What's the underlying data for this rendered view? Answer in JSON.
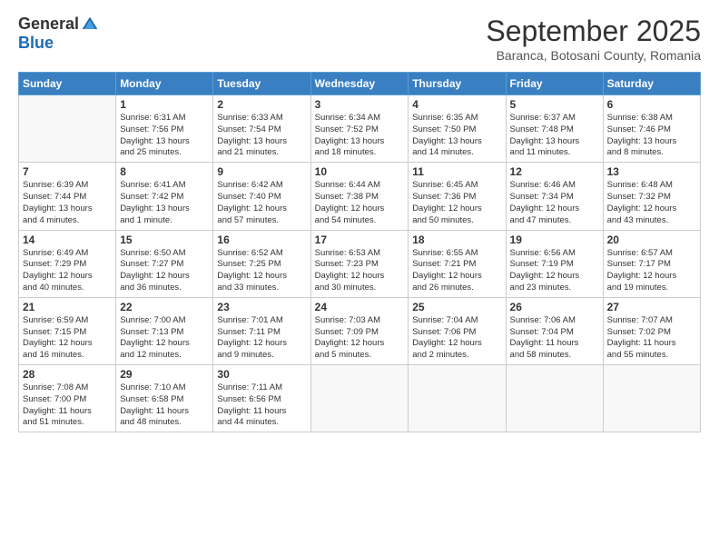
{
  "logo": {
    "general": "General",
    "blue": "Blue"
  },
  "title": "September 2025",
  "location": "Baranca, Botosani County, Romania",
  "days_of_week": [
    "Sunday",
    "Monday",
    "Tuesday",
    "Wednesday",
    "Thursday",
    "Friday",
    "Saturday"
  ],
  "weeks": [
    [
      {
        "day": "",
        "info": ""
      },
      {
        "day": "1",
        "info": "Sunrise: 6:31 AM\nSunset: 7:56 PM\nDaylight: 13 hours\nand 25 minutes."
      },
      {
        "day": "2",
        "info": "Sunrise: 6:33 AM\nSunset: 7:54 PM\nDaylight: 13 hours\nand 21 minutes."
      },
      {
        "day": "3",
        "info": "Sunrise: 6:34 AM\nSunset: 7:52 PM\nDaylight: 13 hours\nand 18 minutes."
      },
      {
        "day": "4",
        "info": "Sunrise: 6:35 AM\nSunset: 7:50 PM\nDaylight: 13 hours\nand 14 minutes."
      },
      {
        "day": "5",
        "info": "Sunrise: 6:37 AM\nSunset: 7:48 PM\nDaylight: 13 hours\nand 11 minutes."
      },
      {
        "day": "6",
        "info": "Sunrise: 6:38 AM\nSunset: 7:46 PM\nDaylight: 13 hours\nand 8 minutes."
      }
    ],
    [
      {
        "day": "7",
        "info": "Sunrise: 6:39 AM\nSunset: 7:44 PM\nDaylight: 13 hours\nand 4 minutes."
      },
      {
        "day": "8",
        "info": "Sunrise: 6:41 AM\nSunset: 7:42 PM\nDaylight: 13 hours\nand 1 minute."
      },
      {
        "day": "9",
        "info": "Sunrise: 6:42 AM\nSunset: 7:40 PM\nDaylight: 12 hours\nand 57 minutes."
      },
      {
        "day": "10",
        "info": "Sunrise: 6:44 AM\nSunset: 7:38 PM\nDaylight: 12 hours\nand 54 minutes."
      },
      {
        "day": "11",
        "info": "Sunrise: 6:45 AM\nSunset: 7:36 PM\nDaylight: 12 hours\nand 50 minutes."
      },
      {
        "day": "12",
        "info": "Sunrise: 6:46 AM\nSunset: 7:34 PM\nDaylight: 12 hours\nand 47 minutes."
      },
      {
        "day": "13",
        "info": "Sunrise: 6:48 AM\nSunset: 7:32 PM\nDaylight: 12 hours\nand 43 minutes."
      }
    ],
    [
      {
        "day": "14",
        "info": "Sunrise: 6:49 AM\nSunset: 7:29 PM\nDaylight: 12 hours\nand 40 minutes."
      },
      {
        "day": "15",
        "info": "Sunrise: 6:50 AM\nSunset: 7:27 PM\nDaylight: 12 hours\nand 36 minutes."
      },
      {
        "day": "16",
        "info": "Sunrise: 6:52 AM\nSunset: 7:25 PM\nDaylight: 12 hours\nand 33 minutes."
      },
      {
        "day": "17",
        "info": "Sunrise: 6:53 AM\nSunset: 7:23 PM\nDaylight: 12 hours\nand 30 minutes."
      },
      {
        "day": "18",
        "info": "Sunrise: 6:55 AM\nSunset: 7:21 PM\nDaylight: 12 hours\nand 26 minutes."
      },
      {
        "day": "19",
        "info": "Sunrise: 6:56 AM\nSunset: 7:19 PM\nDaylight: 12 hours\nand 23 minutes."
      },
      {
        "day": "20",
        "info": "Sunrise: 6:57 AM\nSunset: 7:17 PM\nDaylight: 12 hours\nand 19 minutes."
      }
    ],
    [
      {
        "day": "21",
        "info": "Sunrise: 6:59 AM\nSunset: 7:15 PM\nDaylight: 12 hours\nand 16 minutes."
      },
      {
        "day": "22",
        "info": "Sunrise: 7:00 AM\nSunset: 7:13 PM\nDaylight: 12 hours\nand 12 minutes."
      },
      {
        "day": "23",
        "info": "Sunrise: 7:01 AM\nSunset: 7:11 PM\nDaylight: 12 hours\nand 9 minutes."
      },
      {
        "day": "24",
        "info": "Sunrise: 7:03 AM\nSunset: 7:09 PM\nDaylight: 12 hours\nand 5 minutes."
      },
      {
        "day": "25",
        "info": "Sunrise: 7:04 AM\nSunset: 7:06 PM\nDaylight: 12 hours\nand 2 minutes."
      },
      {
        "day": "26",
        "info": "Sunrise: 7:06 AM\nSunset: 7:04 PM\nDaylight: 11 hours\nand 58 minutes."
      },
      {
        "day": "27",
        "info": "Sunrise: 7:07 AM\nSunset: 7:02 PM\nDaylight: 11 hours\nand 55 minutes."
      }
    ],
    [
      {
        "day": "28",
        "info": "Sunrise: 7:08 AM\nSunset: 7:00 PM\nDaylight: 11 hours\nand 51 minutes."
      },
      {
        "day": "29",
        "info": "Sunrise: 7:10 AM\nSunset: 6:58 PM\nDaylight: 11 hours\nand 48 minutes."
      },
      {
        "day": "30",
        "info": "Sunrise: 7:11 AM\nSunset: 6:56 PM\nDaylight: 11 hours\nand 44 minutes."
      },
      {
        "day": "",
        "info": ""
      },
      {
        "day": "",
        "info": ""
      },
      {
        "day": "",
        "info": ""
      },
      {
        "day": "",
        "info": ""
      }
    ]
  ]
}
